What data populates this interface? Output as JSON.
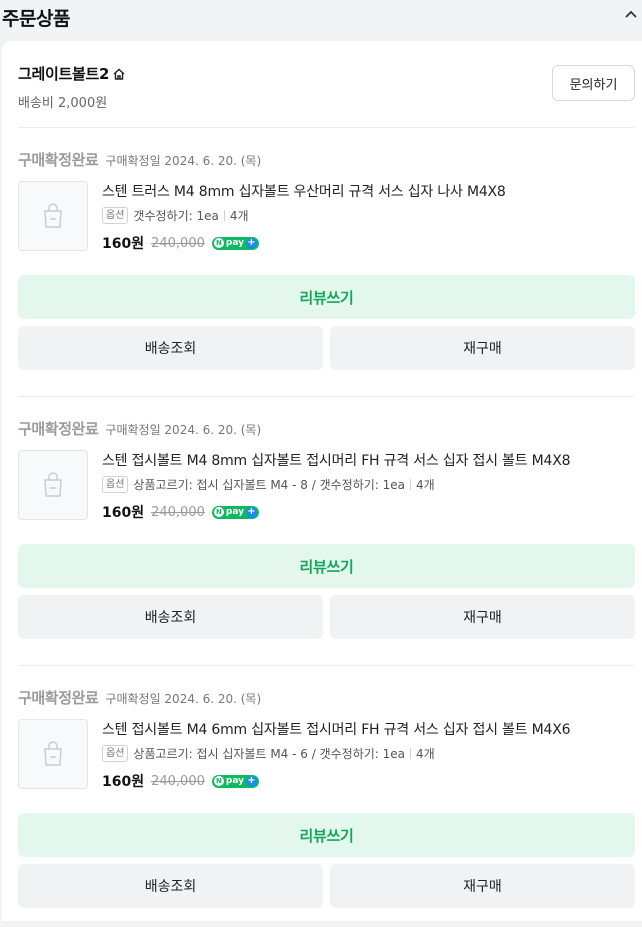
{
  "header": {
    "title": "주문상품"
  },
  "store": {
    "name": "그레이트볼트2",
    "shipping": "배송비 2,000원",
    "inquiry_label": "문의하기"
  },
  "orders": [
    {
      "status": "구매확정완료",
      "confirm_date": "구매확정일 2024. 6. 20. (목)",
      "product_name": "스텐 트러스 M4 8mm 십자볼트 우산머리 규격 서스 십자 나사 M4X8",
      "option_badge": "옵션",
      "option_text": "갯수정하기: 1ea",
      "quantity": "4개",
      "price": "160원",
      "original_price": "240,000",
      "review_label": "리뷰쓰기",
      "track_label": "배송조회",
      "rebuy_label": "재구매"
    },
    {
      "status": "구매확정완료",
      "confirm_date": "구매확정일 2024. 6. 20. (목)",
      "product_name": "스텐 접시볼트 M4 8mm 십자볼트 접시머리 FH 규격 서스 십자 접시 볼트 M4X8",
      "option_badge": "옵션",
      "option_text": "상품고르기: 접시 십자볼트 M4 - 8 / 갯수정하기: 1ea",
      "quantity": "4개",
      "price": "160원",
      "original_price": "240,000",
      "review_label": "리뷰쓰기",
      "track_label": "배송조회",
      "rebuy_label": "재구매"
    },
    {
      "status": "구매확정완료",
      "confirm_date": "구매확정일 2024. 6. 20. (목)",
      "product_name": "스텐 접시볼트 M4 6mm 십자볼트 접시머리 FH 규격 서스 십자 접시 볼트 M4X6",
      "option_badge": "옵션",
      "option_text": "상품고르기: 접시 십자볼트 M4 - 6 / 갯수정하기: 1ea",
      "quantity": "4개",
      "price": "160원",
      "original_price": "240,000",
      "review_label": "리뷰쓰기",
      "track_label": "배송조회",
      "rebuy_label": "재구매"
    }
  ],
  "npay": {
    "mark": "N",
    "text": "pay",
    "plus": "+"
  },
  "colors": {
    "review_bg": "#e3f7ec",
    "review_text": "#14a65a",
    "npay_green": "#0fb95f",
    "npay_blue": "#1b8fe8"
  }
}
